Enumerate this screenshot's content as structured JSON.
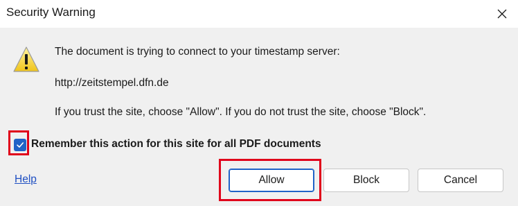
{
  "window": {
    "title": "Security Warning",
    "close_icon": "close-icon"
  },
  "content": {
    "icon": "warning-icon",
    "message_line1": "The document is trying to connect to your timestamp server:",
    "server_url": "http://zeitstempel.dfn.de",
    "trust_message": "If you trust the site, choose \"Allow\".  If you do not trust the site, choose \"Block\"."
  },
  "remember": {
    "checked": true,
    "label": "Remember this action for this site for all PDF documents"
  },
  "footer": {
    "help_label": "Help",
    "allow_label": "Allow",
    "block_label": "Block",
    "cancel_label": "Cancel"
  },
  "colors": {
    "accent": "#2063c7",
    "highlight": "#e0001b",
    "link": "#1f4fc2"
  }
}
